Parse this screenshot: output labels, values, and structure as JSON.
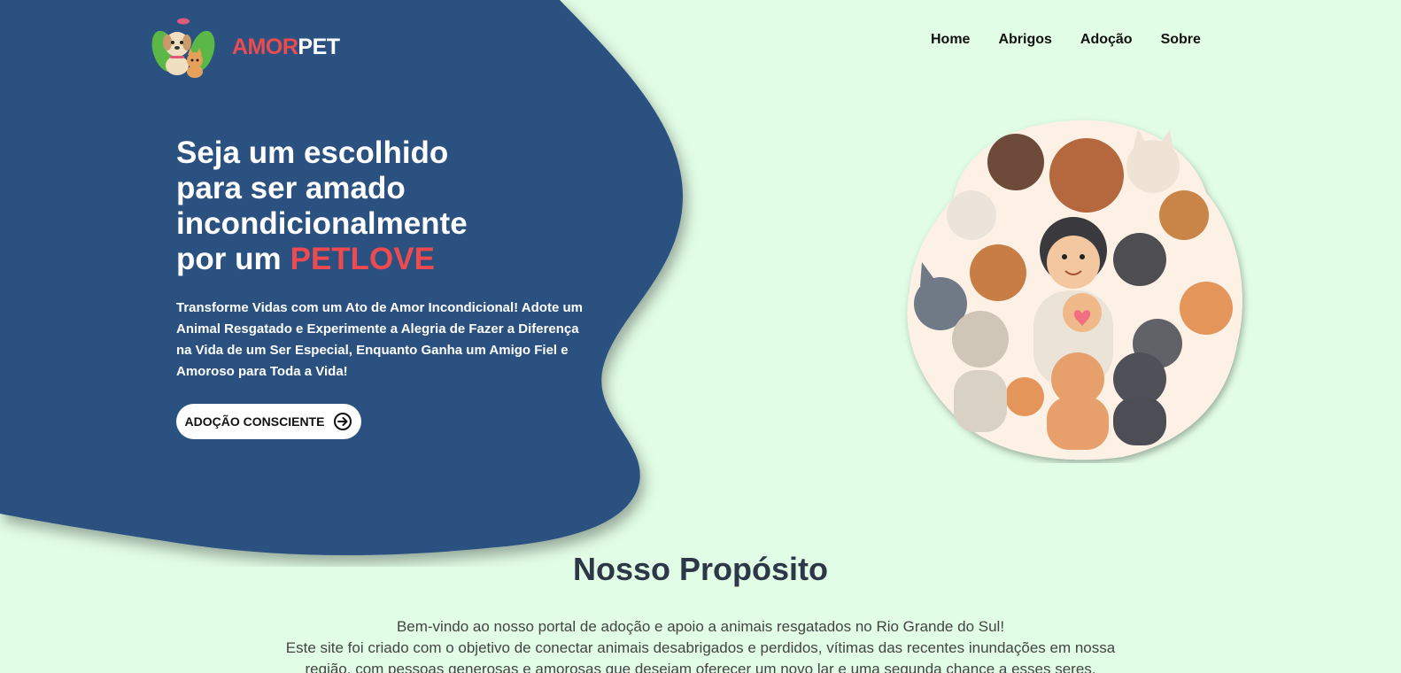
{
  "brand": {
    "part1": "AMOR",
    "part2": "PET"
  },
  "nav": {
    "items": [
      "Home",
      "Abrigos",
      "Adoção",
      "Sobre"
    ]
  },
  "hero": {
    "title_lines": [
      "Seja um escolhido",
      "para ser amado",
      "incondicionalmente",
      "por um"
    ],
    "accent": "PETLOVE",
    "subtitle": "Transforme Vidas com um Ato de Amor Incondicional! Adote um Animal Resgatado e Experimente a Alegria de Fazer a Diferença na Vida de um Ser Especial, Enquanto Ganha um Amigo Fiel e Amoroso para Toda a Vida!",
    "cta_label": "ADOÇÃO CONSCIENTE"
  },
  "purpose": {
    "title": "Nosso Propósito",
    "lines": [
      "Bem-vindo ao nosso portal de adoção e apoio a animais resgatados no Rio Grande do Sul!",
      "Este site foi criado com o objetivo de conectar animais desabrigados e perdidos, vítimas das recentes inundações em nossa",
      "região, com pessoas generosas e amorosas que desejam oferecer um novo lar e uma segunda chance a esses seres."
    ]
  },
  "colors": {
    "background": "#e1fde5",
    "blob": "#2c5180",
    "accent": "#ee4a4f",
    "heading": "#2d3748"
  },
  "icons": {
    "logo": "dog-and-cat-leaf-logo",
    "cta": "arrow-right-circle-icon",
    "hero_image": "pets-group-illustration"
  }
}
